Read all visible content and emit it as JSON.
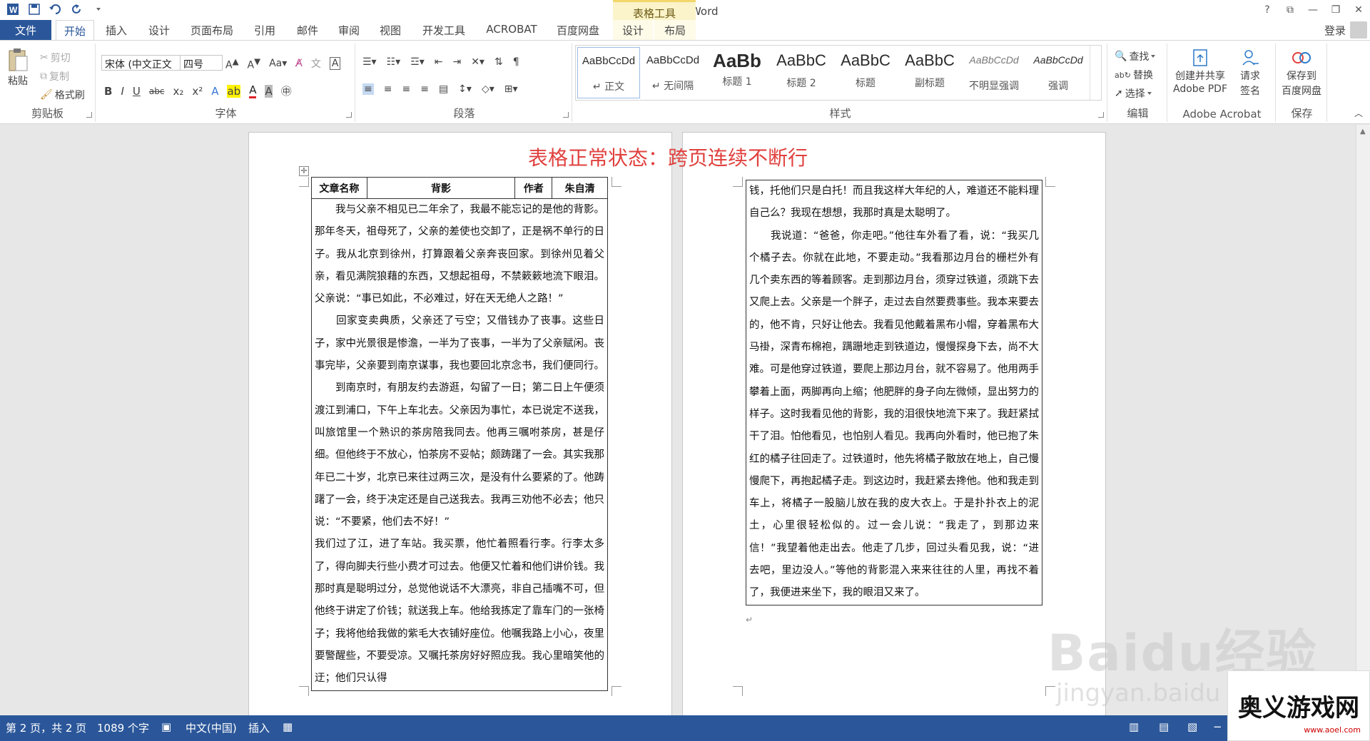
{
  "app": {
    "title": "文档2 - Word",
    "context_tab": "表格工具",
    "signin": "登录",
    "window_controls": [
      "?",
      "⧉",
      "—",
      "❐",
      "✕"
    ]
  },
  "tabs": {
    "file": "文件",
    "items": [
      "开始",
      "插入",
      "设计",
      "页面布局",
      "引用",
      "邮件",
      "审阅",
      "视图",
      "开发工具",
      "ACROBAT",
      "百度网盘"
    ],
    "context_items": [
      "设计",
      "布局"
    ],
    "active": "开始"
  },
  "ribbon": {
    "clipboard": {
      "label": "剪贴板",
      "paste": "粘贴",
      "cut": "剪切",
      "copy": "复制",
      "format_painter": "格式刷"
    },
    "font": {
      "label": "字体",
      "font_name": "宋体 (中文正文",
      "font_size": "四号"
    },
    "paragraph": {
      "label": "段落"
    },
    "styles": {
      "label": "样式",
      "items": [
        {
          "sample": "AaBbCcDd",
          "name": "↵ 正文",
          "selected": true
        },
        {
          "sample": "AaBbCcDd",
          "name": "↵ 无间隔",
          "selected": false
        },
        {
          "sample": "AaBb",
          "name": "标题 1",
          "selected": false
        },
        {
          "sample": "AaBbC",
          "name": "标题 2",
          "selected": false
        },
        {
          "sample": "AaBbC",
          "name": "标题",
          "selected": false
        },
        {
          "sample": "AaBbC",
          "name": "副标题",
          "selected": false
        },
        {
          "sample": "AaBbCcDd",
          "name": "不明显强调",
          "selected": false
        },
        {
          "sample": "AaBbCcDd",
          "name": "强调",
          "selected": false
        }
      ]
    },
    "editing": {
      "label": "编辑",
      "find": "查找",
      "replace": "替换",
      "select": "选择"
    },
    "acrobat": {
      "label": "Adobe Acrobat",
      "create_share_1": "创建并共享",
      "create_share_2": "Adobe PDF",
      "request_sign_1": "请求",
      "request_sign_2": "签名"
    },
    "save": {
      "label": "保存",
      "save_to_1": "保存到",
      "save_to_2": "百度网盘"
    }
  },
  "document": {
    "heading": "表格正常状态：跨页连续不断行",
    "table_header": [
      "文章名称",
      "背影",
      "作者",
      "朱自清"
    ],
    "page1_paragraphs": [
      "　　我与父亲不相见已二年余了，我最不能忘记的是他的背影。",
      "那年冬天，祖母死了，父亲的差使也交卸了，正是祸不单行的日子。我从北京到徐州，打算跟着父亲奔丧回家。到徐州见着父亲，看见满院狼藉的东西，又想起祖母，不禁簌簌地流下眼泪。父亲说：“事已如此，不必难过，好在天无绝人之路！”",
      "　　回家变卖典质，父亲还了亏空；又借钱办了丧事。这些日子，家中光景很是惨澹，一半为了丧事，一半为了父亲赋闲。丧事完毕，父亲要到南京谋事，我也要回北京念书，我们便同行。",
      "　　到南京时，有朋友约去游逛，勾留了一日；第二日上午便须渡江到浦口，下午上车北去。父亲因为事忙，本已说定不送我，叫旅馆里一个熟识的茶房陪我同去。他再三嘱咐茶房，甚是仔细。但他终于不放心，怕茶房不妥帖；颇踌躇了一会。其实我那年已二十岁，北京已来往过两三次，是没有什么要紧的了。他踌躇了一会，终于决定还是自己送我去。我再三劝他不必去；他只说：“不要紧，他们去不好！”",
      "我们过了江，进了车站。我买票，他忙着照看行李。行李太多了，得向脚夫行些小费才可过去。他便又忙着和他们讲价钱。我那时真是聪明过分，总觉他说话不大漂亮，非自己插嘴不可，但他终于讲定了价钱；就送我上车。他给我拣定了靠车门的一张椅子；我将他给我做的紫毛大衣铺好座位。他嘱我路上小心，夜里要警醒些，不要受凉。又嘱托茶房好好照应我。我心里暗笑他的迂；他们只认得"
    ],
    "page2_paragraphs": [
      "钱，托他们只是白托！而且我这样大年纪的人，难道还不能料理自己么？我现在想想，我那时真是太聪明了。",
      "　　我说道：“爸爸，你走吧。”他往车外看了看，说：“我买几个橘子去。你就在此地，不要走动。”我看那边月台的栅栏外有几个卖东西的等着顾客。走到那边月台，须穿过铁道，须跳下去又爬上去。父亲是一个胖子，走过去自然要费事些。我本来要去的，他不肯，只好让他去。我看见他戴着黑布小帽，穿着黑布大马褂，深青布棉袍，蹒跚地走到铁道边，慢慢探身下去，尚不大难。可是他穿过铁道，要爬上那边月台，就不容易了。他用两手攀着上面，两脚再向上缩；他肥胖的身子向左微倾，显出努力的样子。这时我看见他的背影，我的泪很快地流下来了。我赶紧拭干了泪。怕他看见，也怕别人看见。我再向外看时，他已抱了朱红的橘子往回走了。过铁道时，他先将橘子散放在地上，自己慢慢爬下，再抱起橘子走。到这边时，我赶紧去搀他。他和我走到车上，将橘子一股脑儿放在我的皮大衣上。于是扑扑衣上的泥土，心里很轻松似的。过一会儿说：“我走了，到那边来信！”我望着他走出去。他走了几步，回过头看见我，说：“进去吧，里边没人。”等他的背影混入来来往往的人里，再找不着了，我便进来坐下，我的眼泪又来了。"
    ]
  },
  "statusbar": {
    "page": "第 2 页，共 2 页",
    "words": "1089 个字",
    "language": "中文(中国)",
    "mode": "插入"
  },
  "watermarks": {
    "baidu": "Baidu经验",
    "baidu_url": "jingyan.baidu",
    "site_name": "奥义游戏网",
    "site_url": "www.aoel.com"
  },
  "colors": {
    "accent": "#2b579a",
    "heading_red": "#e0413e",
    "context_tab_bg": "#fbf3c9"
  }
}
